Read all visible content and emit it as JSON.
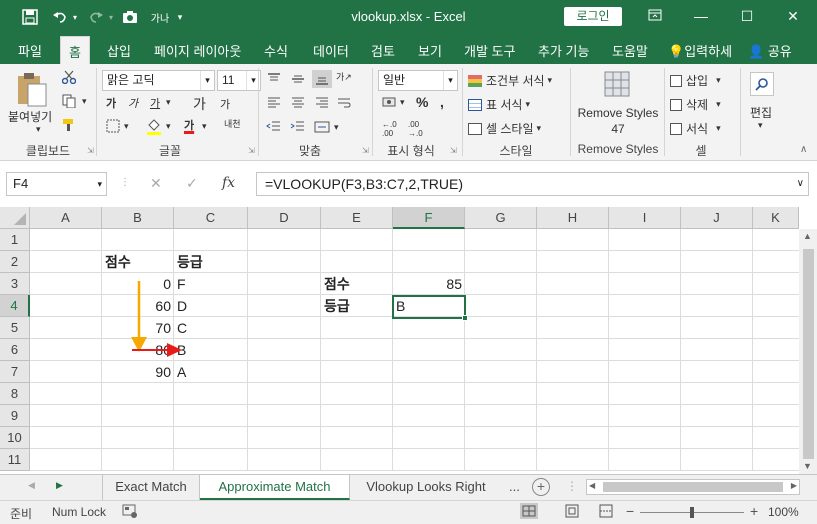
{
  "window": {
    "title": "vlookup.xlsx  -  Excel",
    "login_label": "로그인",
    "minimize": "—",
    "maximize": "☐",
    "close": "✕",
    "ribbon_display": "⊡"
  },
  "quick_access": {
    "save": "💾",
    "undo": "↶",
    "redo": "↷",
    "camera": "📷",
    "custom": "가나"
  },
  "tabs": [
    "파일",
    "홈",
    "삽입",
    "페이지 레이아웃",
    "수식",
    "데이터",
    "검토",
    "보기",
    "개발 도구",
    "추가 기능",
    "도움말",
    "입력하세",
    "공유"
  ],
  "ribbon": {
    "clipboard": {
      "paste_label": "붙여넣기",
      "group": "클립보드"
    },
    "font": {
      "name": "맑은 고딕",
      "size": "11",
      "group": "글꼴",
      "bold": "가",
      "italic": "가",
      "underline": "가",
      "grow": "가",
      "shrink": "가",
      "phonetic": "내천"
    },
    "alignment": {
      "group": "맞춤"
    },
    "number": {
      "format": "일반",
      "group": "표시 형식"
    },
    "styles": {
      "conditional": "조건부 서식",
      "table": "표 서식",
      "cell": "셀 스타일",
      "group": "스타일"
    },
    "remove_styles": {
      "label1": "Remove Styles",
      "count": "47",
      "group": "Remove Styles"
    },
    "cells": {
      "insert": "삽입",
      "delete": "삭제",
      "format": "서식",
      "group": "셀"
    },
    "editing": {
      "label": "편집"
    }
  },
  "formula_bar": {
    "name_box": "F4",
    "formula": "=VLOOKUP(F3,B3:C7,2,TRUE)",
    "cancel": "✕",
    "enter": "✓",
    "fx": "fx"
  },
  "columns": [
    "A",
    "B",
    "C",
    "D",
    "E",
    "F",
    "G",
    "H",
    "I",
    "J",
    "K"
  ],
  "rows": [
    "1",
    "2",
    "3",
    "4",
    "5",
    "6",
    "7",
    "8",
    "9",
    "10",
    "11"
  ],
  "cells": {
    "B2": "점수",
    "C2": "등급",
    "B3": "0",
    "C3": "F",
    "B4": "60",
    "C4": "D",
    "B5": "70",
    "C5": "C",
    "B6": "80",
    "C6": "B",
    "B7": "90",
    "C7": "A",
    "E3": "점수",
    "F3": "85",
    "E4": "등급",
    "F4": "B"
  },
  "sheets": [
    "Exact Match",
    "Approximate Match",
    "Vlookup Looks Right"
  ],
  "sheet_more": "...",
  "status": {
    "ready": "준비",
    "numlock": "Num Lock",
    "zoom": "100%"
  },
  "colors": {
    "accent": "#217346",
    "arrow_down": "#f5a800",
    "arrow_right": "#e81b1b"
  }
}
